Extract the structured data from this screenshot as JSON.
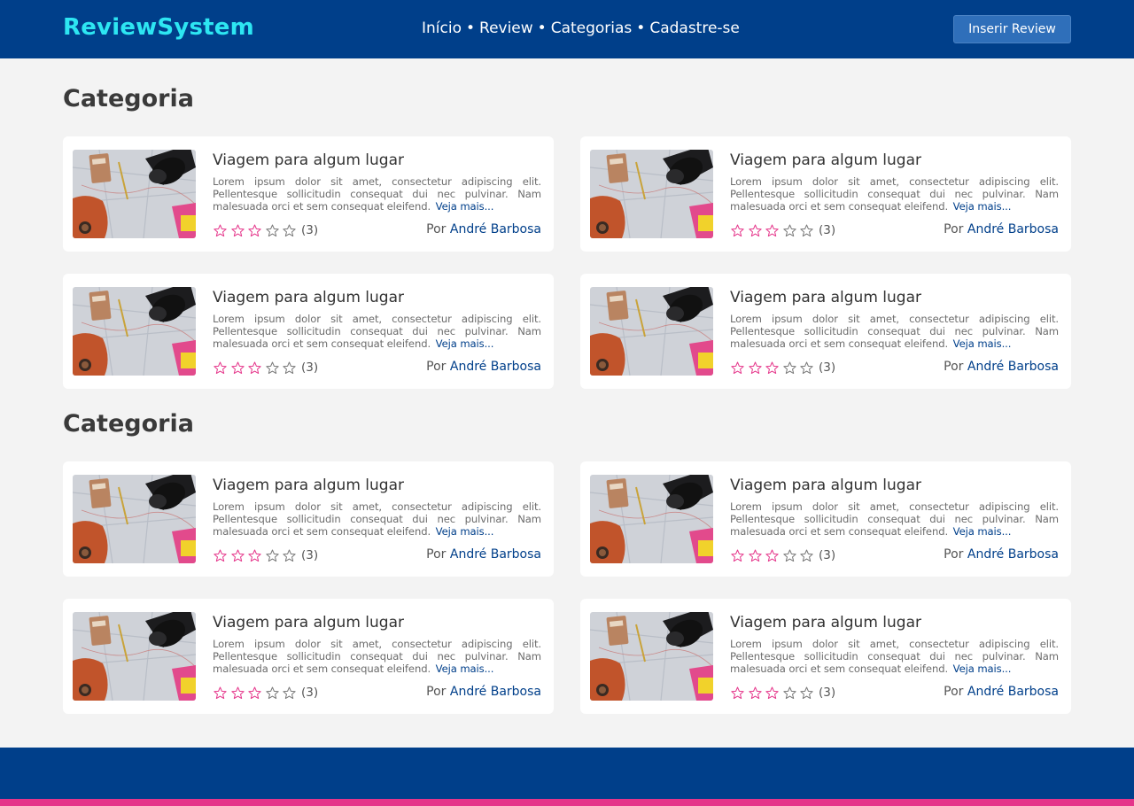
{
  "header": {
    "brand": "ReviewSystem",
    "nav": [
      "Início",
      "Review",
      "Categorias",
      "Cadastre-se"
    ],
    "nav_separator": "•",
    "insert_button": "Inserir Review"
  },
  "sections": [
    {
      "title": "Categoria",
      "cards": [
        {
          "title": "Viagem para algum lugar",
          "description": "Lorem ipsum dolor sit amet, consectetur adipiscing elit. Pellentesque sollicitudin consequat dui nec pulvinar. Nam malesuada orci et sem consequat eleifend.",
          "more": "Veja mais...",
          "rating": 3,
          "rating_max": 5,
          "count": "(3)",
          "by": "Por",
          "author": "André Barbosa"
        },
        {
          "title": "Viagem para algum lugar",
          "description": "Lorem ipsum dolor sit amet, consectetur adipiscing elit. Pellentesque sollicitudin consequat dui nec pulvinar. Nam malesuada orci et sem consequat eleifend.",
          "more": "Veja mais...",
          "rating": 3,
          "rating_max": 5,
          "count": "(3)",
          "by": "Por",
          "author": "André Barbosa"
        },
        {
          "title": "Viagem para algum lugar",
          "description": "Lorem ipsum dolor sit amet, consectetur adipiscing elit. Pellentesque sollicitudin consequat dui nec pulvinar. Nam malesuada orci et sem consequat eleifend.",
          "more": "Veja mais...",
          "rating": 3,
          "rating_max": 5,
          "count": "(3)",
          "by": "Por",
          "author": "André Barbosa"
        },
        {
          "title": "Viagem para algum lugar",
          "description": "Lorem ipsum dolor sit amet, consectetur adipiscing elit. Pellentesque sollicitudin consequat dui nec pulvinar. Nam malesuada orci et sem consequat eleifend.",
          "more": "Veja mais...",
          "rating": 3,
          "rating_max": 5,
          "count": "(3)",
          "by": "Por",
          "author": "André Barbosa"
        }
      ]
    },
    {
      "title": "Categoria",
      "cards": [
        {
          "title": "Viagem para algum lugar",
          "description": "Lorem ipsum dolor sit amet, consectetur adipiscing elit. Pellentesque sollicitudin consequat dui nec pulvinar. Nam malesuada orci et sem consequat eleifend.",
          "more": "Veja mais...",
          "rating": 3,
          "rating_max": 5,
          "count": "(3)",
          "by": "Por",
          "author": "André Barbosa"
        },
        {
          "title": "Viagem para algum lugar",
          "description": "Lorem ipsum dolor sit amet, consectetur adipiscing elit. Pellentesque sollicitudin consequat dui nec pulvinar. Nam malesuada orci et sem consequat eleifend.",
          "more": "Veja mais...",
          "rating": 3,
          "rating_max": 5,
          "count": "(3)",
          "by": "Por",
          "author": "André Barbosa"
        },
        {
          "title": "Viagem para algum lugar",
          "description": "Lorem ipsum dolor sit amet, consectetur adipiscing elit. Pellentesque sollicitudin consequat dui nec pulvinar. Nam malesuada orci et sem consequat eleifend.",
          "more": "Veja mais...",
          "rating": 3,
          "rating_max": 5,
          "count": "(3)",
          "by": "Por",
          "author": "André Barbosa"
        },
        {
          "title": "Viagem para algum lugar",
          "description": "Lorem ipsum dolor sit amet, consectetur adipiscing elit. Pellentesque sollicitudin consequat dui nec pulvinar. Nam malesuada orci et sem consequat eleifend.",
          "more": "Veja mais...",
          "rating": 3,
          "rating_max": 5,
          "count": "(3)",
          "by": "Por",
          "author": "André Barbosa"
        }
      ]
    }
  ],
  "colors": {
    "header_bg": "#003f8a",
    "brand": "#2de6f2",
    "button_bg": "#2f6fba",
    "star_filled": "#e5358a",
    "star_empty": "#777777",
    "link": "#003f8a",
    "footer_accent": "#e5358a"
  },
  "icons": {
    "star_filled": "star-outline-pink-icon",
    "star_empty": "star-outline-gray-icon",
    "thumbnail": "travel-flatlay-photo"
  }
}
